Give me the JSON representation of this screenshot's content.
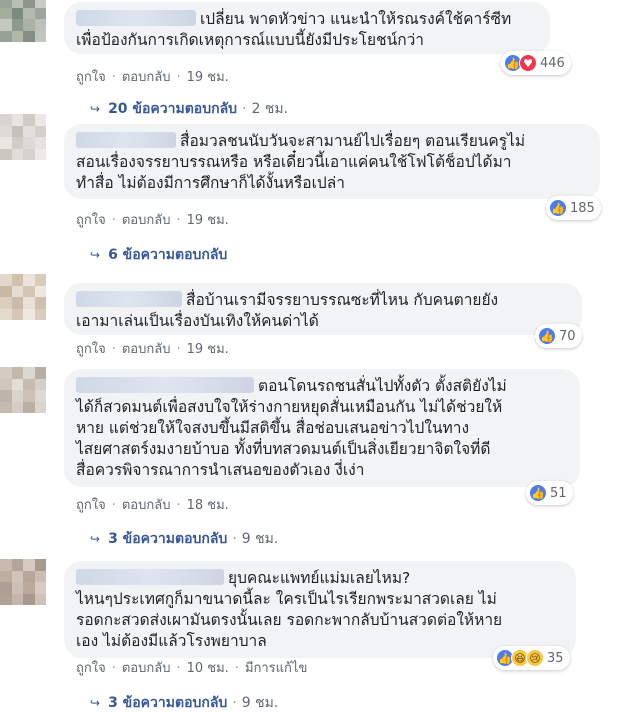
{
  "comments": [
    {
      "text": "เปลี่ยน พาดหัวข่าว แนะนำให้รณรงค์ใช้คาร์ซีท\nเพื่อป้องกันการเกิดเหตุการณ์แบบนี้ยังมีประโยชน์กว่า",
      "like": "ถูกใจ",
      "reply": "ตอบกลับ",
      "time": "19 ชม.",
      "reaction_count": "446",
      "replies": {
        "label": "20 ข้อความตอบกลับ",
        "time": "2 ชม."
      }
    },
    {
      "text": "สื่อมวลชนนับวันจะสามานย์ไปเรื่อยๆ ตอนเรียนครูไม่\nสอนเรื่องจรรยาบรรณหรือ หรือเดี๋ยวนี้เอาแค่คนใช้โฟโต้ช็อปได้มา\nทำสื่อ ไม่ต้องมีการศึกษาก็ได้งั้นหรือเปล่า",
      "like": "ถูกใจ",
      "reply": "ตอบกลับ",
      "time": "19 ชม.",
      "reaction_count": "185",
      "replies": {
        "label": "6 ข้อความตอบกลับ",
        "time": ""
      }
    },
    {
      "text": "สื่อบ้านเรามีจรรยาบรรณซะที่ไหน กับคนตายยัง\nเอามาเล่นเป็นเรื่องบันเทิงให้คนด่าได้",
      "like": "ถูกใจ",
      "reply": "ตอบกลับ",
      "time": "19 ชม.",
      "reaction_count": "70"
    },
    {
      "text": "ตอนโดนรถชนสั่นไปทั้งตัว ตั้งสติยังไม่\nได้ก็สวดมนต์เพื่อสงบใจให้ร่างกายหยุดสั่นเหมือนกัน ไม่ได้ช่วยให้\nหาย แต่ช่วยให้ใจสงบขึ้นมีสติขึ้น สื่อช่อบเสนอข่าวไปในทาง\nไสยศาสตร์งมงายบ้าบอ ทั้งที่บทสวดมนต์เป็นสิ่งเยียวยาจิตใจที่ดี\nสื่อควรพิจารณาการนำเสนอของตัวเอง งี่เง่า",
      "like": "ถูกใจ",
      "reply": "ตอบกลับ",
      "time": "18 ชม.",
      "reaction_count": "51",
      "replies": {
        "label": "3 ข้อความตอบกลับ",
        "time": "9 ชม."
      }
    },
    {
      "text": "ยุบคณะแพทย์แม่มเลยไหม?\nไหนๆประเทศกูก็มาขนาดนี้ละ ใครเป็นไรเรียกพระมาสวดเลย ไม่\nรอดกะสวดส่งเผามันตรงนั้นเลย รอดกะพากลับบ้านสวดต่อให้หาย\nเอง ไม่ต้องมีแล้วโรงพยาบาล",
      "like": "ถูกใจ",
      "reply": "ตอบกลับ",
      "time": "10 ชม.",
      "edited": "มีการแก้ไข",
      "reaction_count": "35",
      "replies": {
        "label": "3 ข้อความตอบกลับ",
        "time": "9 ชม."
      }
    }
  ],
  "colors": {
    "link": "#385898",
    "meta": "#606770",
    "bubble": "#f2f3f5"
  },
  "icons": [
    "like-icon",
    "love-icon",
    "haha-icon",
    "sad-icon",
    "reply-arrow-icon"
  ]
}
